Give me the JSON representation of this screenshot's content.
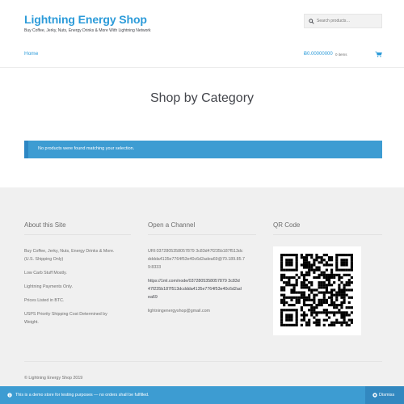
{
  "header": {
    "site_title": "Lightning Energy Shop",
    "tagline": "Buy Coffee, Jerky, Nuts, Energy Drinks & More With Lightning Network",
    "search_placeholder": "Search products…",
    "nav_home": "Home",
    "cart_total": "Ƀ0.00000000",
    "cart_count": "0 items"
  },
  "main": {
    "page_title": "Shop by Category",
    "notice": "No products were found matching your selection."
  },
  "footer": {
    "about": {
      "heading": "About this Site",
      "lines": [
        "Buy Coffee, Jerky, Nuts, Energy Drinks & More.",
        "(U.S. Shipping Only)",
        "Low Carb Stuff Mostly.",
        "Lightning Payments Only.",
        "Prices Listed in BTC.",
        "USPS Priority Shipping Cost Determined by",
        "Weight."
      ]
    },
    "channel": {
      "heading": "Open a Channel",
      "uri_lines": [
        "URI:0372805358057879 3c83d47f235b187f513dc",
        "dddda4135e7764f53e40c6d2adea69@70.189.85.7",
        "9:8333"
      ],
      "link_lines": [
        "https://1ml.com/node/0372805358057879 3c83d",
        "47f235b187f513dcddda4135e7764f53e40c6d2ad",
        "ea69"
      ],
      "email": "lightningenergyshop@gmail.com"
    },
    "qr": {
      "heading": "QR Code"
    },
    "copyright": "© Lightning Energy Shop 2019"
  },
  "demo_bar": {
    "text": "This is a demo store for testing purposes — no orders shall be fulfilled.",
    "dismiss": "Dismiss"
  },
  "colors": {
    "accent": "#2c9bd9",
    "notice_bg": "#3d9cd2",
    "footer_bg": "#f0f0f0"
  }
}
